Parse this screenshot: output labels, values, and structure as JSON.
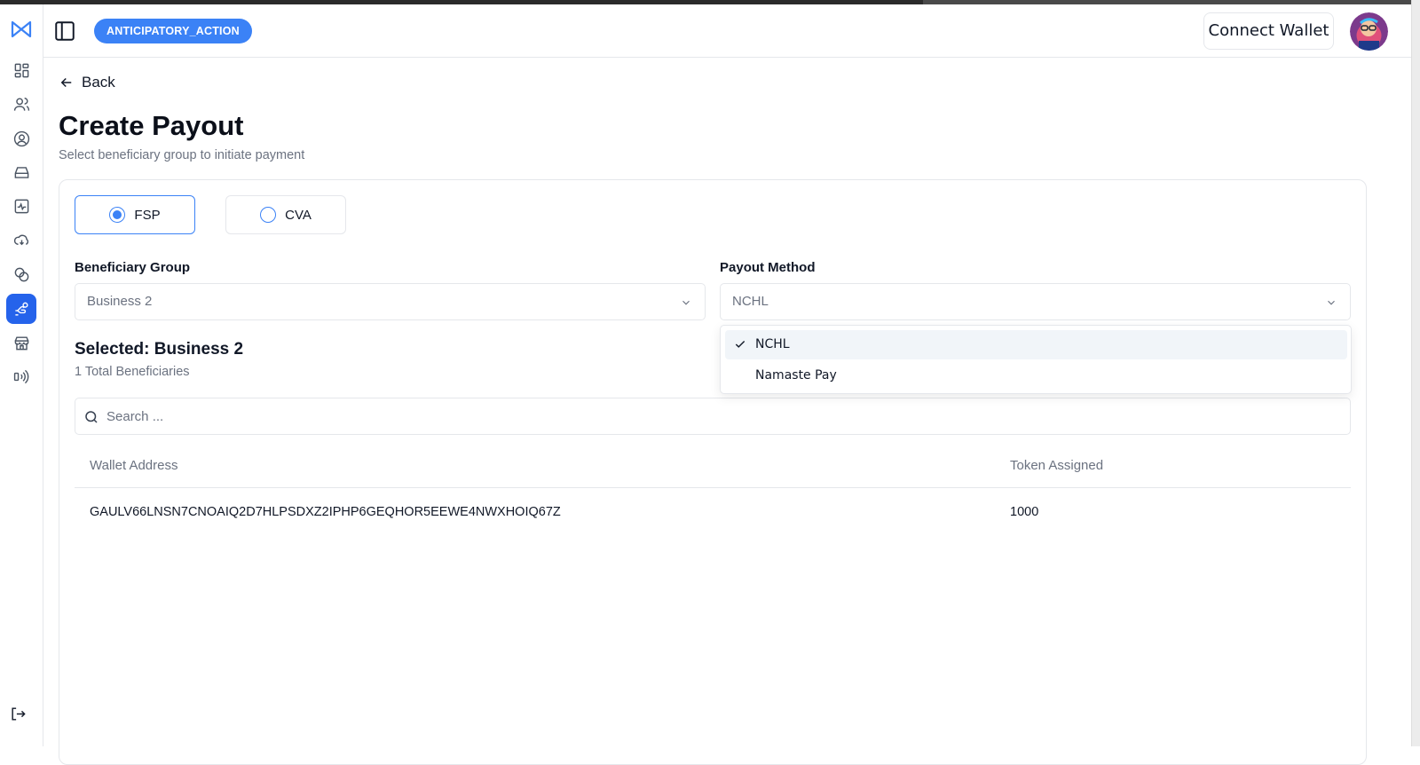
{
  "header": {
    "badge": "ANTICIPATORY_ACTION",
    "connect_wallet": "Connect Wallet"
  },
  "sidebar": {
    "icons": [
      "dashboard-icon",
      "users-icon",
      "user-circle-icon",
      "inbox-icon",
      "activity-icon",
      "cloud-icon",
      "coins-icon",
      "payout-icon",
      "store-icon",
      "broadcast-icon"
    ],
    "active": "payout-icon",
    "logout_icon": "logout-icon"
  },
  "page": {
    "back_label": "Back",
    "title": "Create Payout",
    "subtitle": "Select beneficiary group to initiate payment"
  },
  "payment_type": {
    "options": [
      "FSP",
      "CVA"
    ],
    "selected": "FSP"
  },
  "beneficiary_group": {
    "label": "Beneficiary Group",
    "value": "Business 2"
  },
  "payout_method": {
    "label": "Payout Method",
    "value": "NCHL",
    "options": [
      "NCHL",
      "Namaste Pay"
    ],
    "selected": "NCHL"
  },
  "selection": {
    "title": "Selected: Business 2",
    "count_text": "1 Total Beneficiaries"
  },
  "search": {
    "placeholder": "Search ..."
  },
  "table": {
    "columns": [
      "Wallet Address",
      "Token Assigned"
    ],
    "rows": [
      {
        "wallet": "GAULV66LNSN7CNOAIQ2D7HLPSDXZ2IPHP6GEQHOR5EEWE4NWXHOIQ67Z",
        "tokens": "1000"
      }
    ]
  },
  "colors": {
    "accent": "#3b82f6",
    "active_sidebar": "#2563eb"
  }
}
